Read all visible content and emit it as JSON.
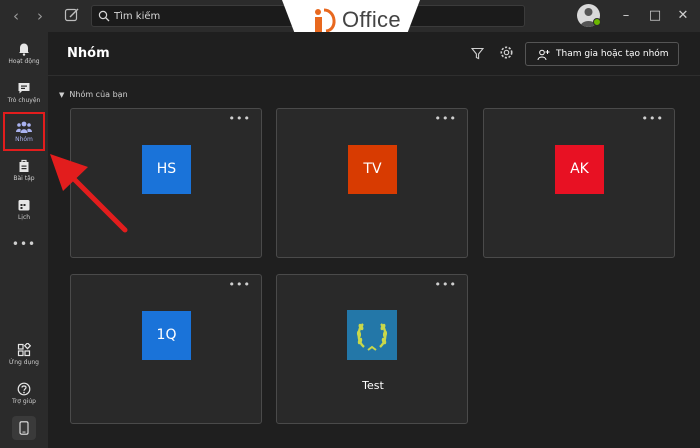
{
  "titlebar": {
    "search_placeholder": "Tìm kiếm",
    "brand_text": "Office",
    "nav_back": "‹",
    "nav_forward": "›",
    "win_min": "–",
    "win_max": "□",
    "win_close": "✕"
  },
  "rail": {
    "items": [
      {
        "label": "Hoạt động",
        "icon": "bell-icon"
      },
      {
        "label": "Trò chuyện",
        "icon": "chat-icon"
      },
      {
        "label": "Nhóm",
        "icon": "teams-icon",
        "active": true
      },
      {
        "label": "Bài tập",
        "icon": "assignments-icon"
      },
      {
        "label": "Lịch",
        "icon": "calendar-icon"
      }
    ],
    "more": "•••",
    "bottom_items": [
      {
        "label": "Ứng dụng",
        "icon": "apps-icon"
      },
      {
        "label": "Trợ giúp",
        "icon": "help-icon"
      }
    ]
  },
  "header": {
    "title": "Nhóm",
    "join_button": "Tham gia hoặc tạo nhóm"
  },
  "section": {
    "title": "Nhóm của bạn"
  },
  "teams": [
    {
      "initials": "HS",
      "color": "#1a73d9",
      "name": ""
    },
    {
      "initials": "TV",
      "color": "#d83b01",
      "name": ""
    },
    {
      "initials": "AK",
      "color": "#e81123",
      "name": ""
    },
    {
      "initials": "1Q",
      "color": "#1a73d9",
      "name": ""
    },
    {
      "initials": "",
      "color": "#2377a8",
      "name": "Test"
    }
  ],
  "card_more": "•••",
  "colors": {
    "accent": "#a9b2f0",
    "highlight": "#e21d1d",
    "brand_orange": "#e8681e"
  }
}
